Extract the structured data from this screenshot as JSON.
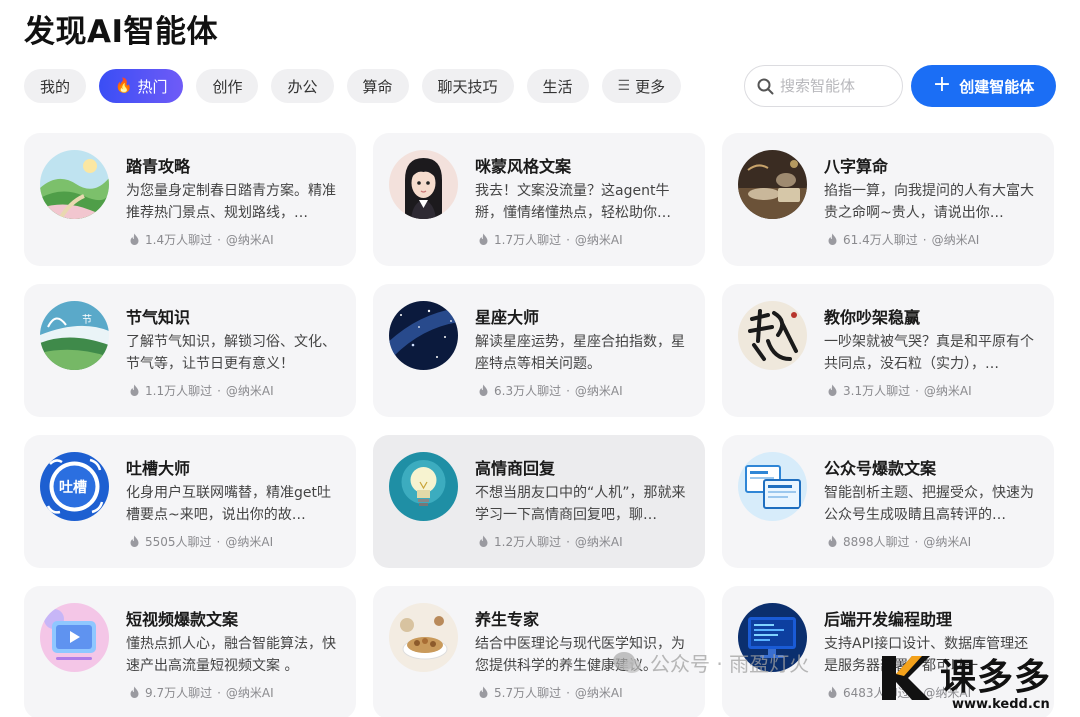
{
  "page": {
    "title": "发现AI智能体"
  },
  "tabs": [
    {
      "label": "我的",
      "icon": ""
    },
    {
      "label": "热门",
      "icon": "🔥"
    },
    {
      "label": "创作",
      "icon": ""
    },
    {
      "label": "办公",
      "icon": ""
    },
    {
      "label": "算命",
      "icon": ""
    },
    {
      "label": "聊天技巧",
      "icon": ""
    },
    {
      "label": "生活",
      "icon": ""
    },
    {
      "label": "更多",
      "icon": "☰"
    }
  ],
  "search": {
    "placeholder": "搜索智能体",
    "icon": "search-icon"
  },
  "create_button": {
    "label": "创建智能体",
    "icon": "plus-icon"
  },
  "colors": {
    "accent": "#1b6ef5",
    "active_tab_start": "#3a4ef5",
    "active_tab_end": "#6f5bf7",
    "card_bg": "#f5f5f7"
  },
  "cards": [
    {
      "title": "踏青攻略",
      "desc": "为您量身定制春日踏青方案。精准推荐热门景点、规划路线，…",
      "count": "1.4万人聊过",
      "author": "@纳米AI",
      "avatar": "spring-landscape"
    },
    {
      "title": "咪蒙风格文案",
      "desc": "我去！文案没流量？这agent牛掰，懂情绪懂热点，轻松助你…",
      "count": "1.7万人聊过",
      "author": "@纳米AI",
      "avatar": "girl-portrait"
    },
    {
      "title": "八字算命",
      "desc": "掐指一算，向我提问的人有大富大贵之命啊~贵人，请说出你…",
      "count": "61.4万人聊过",
      "author": "@纳米AI",
      "avatar": "fortune-table"
    },
    {
      "title": "节气知识",
      "desc": "了解节气知识，解锁习俗、文化、节气等，让节日更有意义！",
      "count": "1.1万人聊过",
      "author": "@纳米AI",
      "avatar": "solar-term"
    },
    {
      "title": "星座大师",
      "desc": "解读星座运势，星座合拍指数，星座特点等相关问题。",
      "count": "6.3万人聊过",
      "author": "@纳米AI",
      "avatar": "starry-sky"
    },
    {
      "title": "教你吵架稳赢",
      "desc": "一吵架就被气哭？真是和平原有个共同点，没石粒（实力），…",
      "count": "3.1万人聊过",
      "author": "@纳米AI",
      "avatar": "calligraphy-win"
    },
    {
      "title": "吐槽大师",
      "desc": "化身用户互联网嘴替，精准get吐槽要点~来吧，说出你的故…",
      "count": "5505人聊过",
      "author": "@纳米AI",
      "avatar": "tucao-badge"
    },
    {
      "title": "高情商回复",
      "desc": "不想当朋友口中的“人机”，那就来学习一下高情商回复吧，聊…",
      "count": "1.2万人聊过",
      "author": "@纳米AI",
      "avatar": "lightbulb"
    },
    {
      "title": "公众号爆款文案",
      "desc": "智能剖析主题、把握受众，快速为公众号生成吸睛且高转评的…",
      "count": "8898人聊过",
      "author": "@纳米AI",
      "avatar": "screens"
    },
    {
      "title": "短视频爆款文案",
      "desc": "懂热点抓人心，融合智能算法，快速产出高流量短视频文案 。",
      "count": "9.7万人聊过",
      "author": "@纳米AI",
      "avatar": "video-player"
    },
    {
      "title": "养生专家",
      "desc": "结合中医理论与现代医学知识，为您提供科学的养生健康建议。",
      "count": "5.7万人聊过",
      "author": "@纳米AI",
      "avatar": "health-food"
    },
    {
      "title": "后端开发编程助理",
      "desc": "支持API接口设计、数据库管理还是服务器部署，都可以一",
      "count": "6483人聊过",
      "author": "@纳米AI",
      "avatar": "code-monitor"
    }
  ],
  "meta_separator": "·",
  "watermark": {
    "text": "公众号 · 雨盈灯火",
    "brand": "课多多",
    "url": "www.kedd.cn"
  }
}
